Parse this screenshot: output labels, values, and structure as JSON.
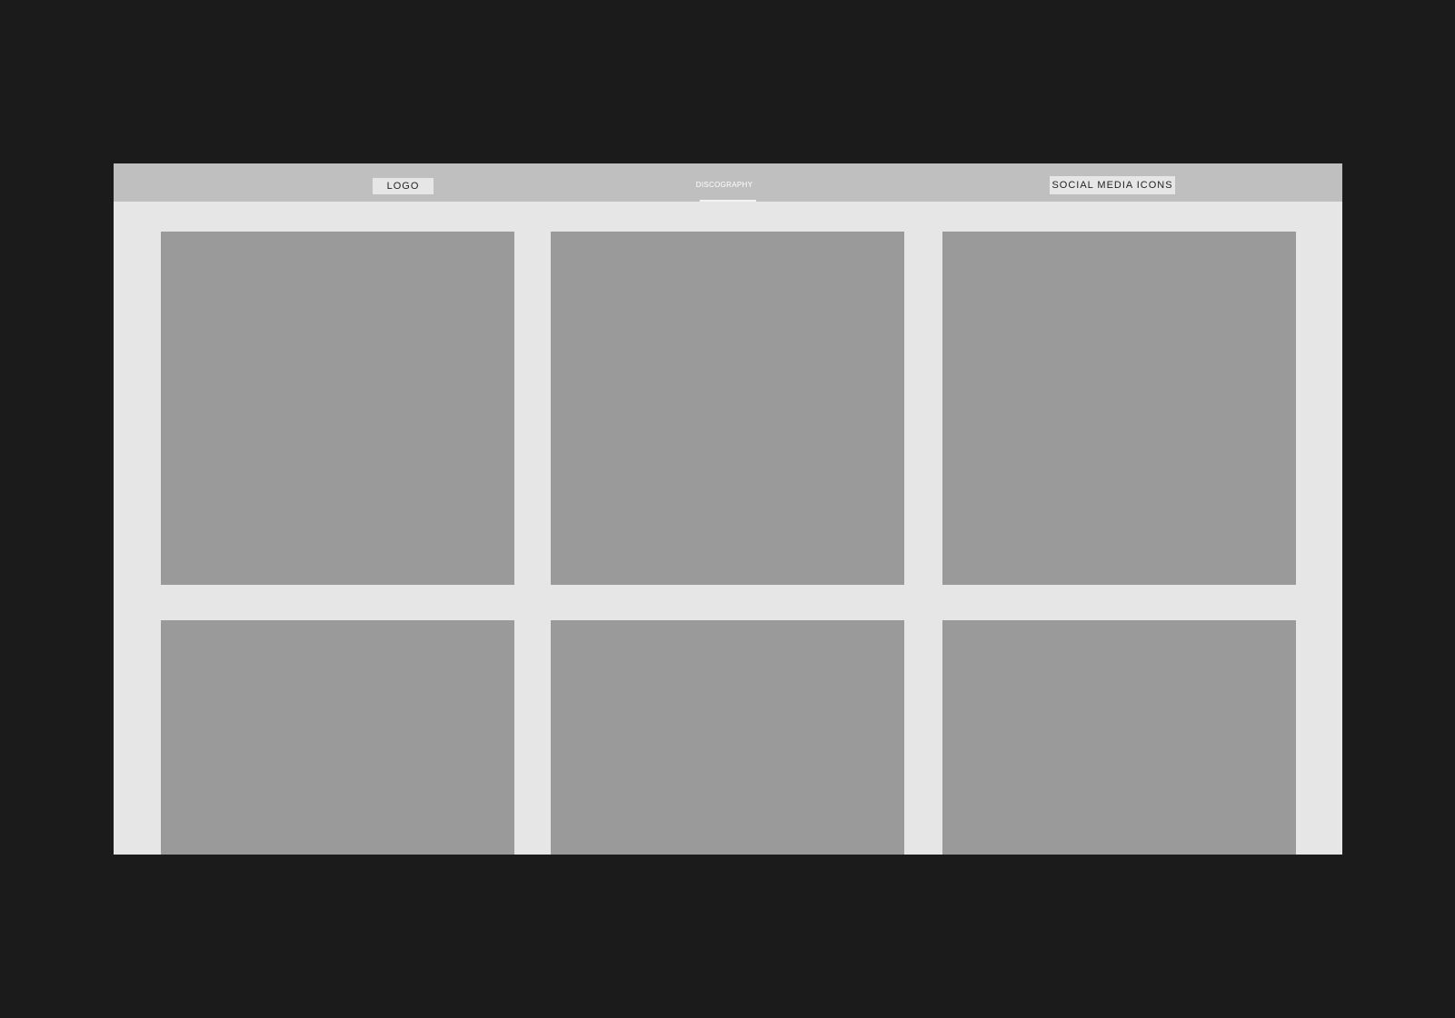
{
  "header": {
    "logo_label": "LOGO",
    "nav_items": [
      {
        "label": "DISCOGRAPHY",
        "active": true
      }
    ],
    "social_label": "SOCIAL MEDIA ICONS"
  },
  "gallery": {
    "tiles": [
      "album-1",
      "album-2",
      "album-3",
      "album-4",
      "album-5",
      "album-6"
    ]
  },
  "colors": {
    "outer_background": "#1b1b1b",
    "page_background": "#e6e6e6",
    "nav_background": "#bfbfbf",
    "tile_placeholder": "#9a9a9a"
  }
}
